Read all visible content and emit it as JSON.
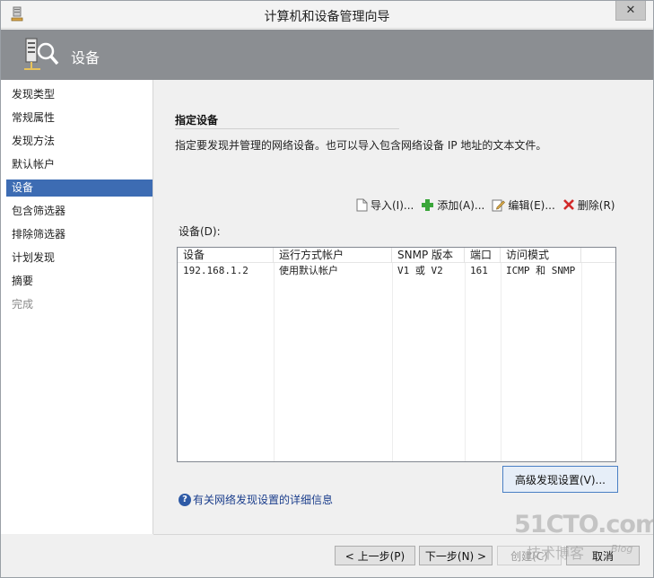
{
  "window": {
    "title": "计算机和设备管理向导",
    "close_label": "✕"
  },
  "banner": {
    "title": "设备"
  },
  "nav": {
    "items": [
      {
        "label": "发现类型",
        "state": "normal"
      },
      {
        "label": "常规属性",
        "state": "normal"
      },
      {
        "label": "发现方法",
        "state": "normal"
      },
      {
        "label": "默认帐户",
        "state": "normal"
      },
      {
        "label": "设备",
        "state": "selected"
      },
      {
        "label": "包含筛选器",
        "state": "normal"
      },
      {
        "label": "排除筛选器",
        "state": "normal"
      },
      {
        "label": "计划发现",
        "state": "normal"
      },
      {
        "label": "摘要",
        "state": "normal"
      },
      {
        "label": "完成",
        "state": "disabled"
      }
    ]
  },
  "main": {
    "section_title": "指定设备",
    "description": "指定要发现并管理的网络设备。也可以导入包含网络设备 IP 地址的文本文件。",
    "toolbar": {
      "import_label": "导入(I)...",
      "add_label": "添加(A)...",
      "edit_label": "编辑(E)...",
      "delete_label": "删除(R)"
    },
    "list_label": "设备(D):",
    "columns": [
      "设备",
      "运行方式帐户",
      "SNMP 版本",
      "端口",
      "访问模式"
    ],
    "rows": [
      [
        "192.168.1.2",
        "使用默认帐户",
        "V1 或 V2",
        "161",
        "ICMP 和 SNMP"
      ]
    ],
    "advanced_button": "高级发现设置(V)...",
    "help_link": "有关网络发现设置的详细信息"
  },
  "footer": {
    "prev_label": "< 上一步(P)",
    "next_label": "下一步(N) >",
    "create_label": "创建(C)",
    "cancel_label": "取消"
  },
  "watermark": {
    "brand": "51CTO.com",
    "sub": "技术博客",
    "blog": "Blog"
  },
  "colors": {
    "banner": "#8b8e92",
    "selected_nav": "#3d6cb3",
    "link": "#1b3e8c",
    "add_icon": "#3aa63a",
    "delete_icon": "#d22a2a"
  }
}
